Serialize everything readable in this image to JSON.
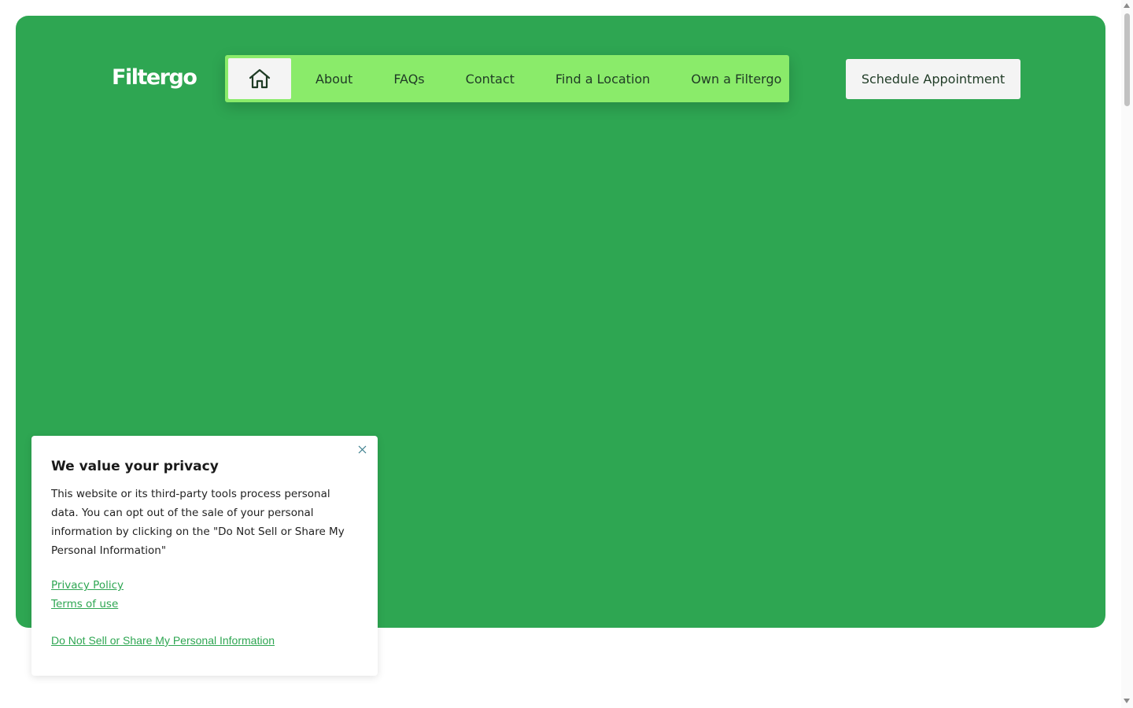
{
  "header": {
    "logo_text": "Filtergo",
    "nav": {
      "home_icon": "home-icon",
      "items": [
        {
          "label": "About"
        },
        {
          "label": "FAQs"
        },
        {
          "label": "Contact"
        },
        {
          "label": "Find a Location"
        },
        {
          "label": "Own a Filtergo"
        }
      ]
    },
    "cta_label": "Schedule Appointment"
  },
  "privacy_banner": {
    "title": "We value your privacy",
    "body": "This website or its third-party tools process personal data. You can opt out of the sale of your personal information by clicking on the \"Do Not Sell or Share My Personal Information\"",
    "links": {
      "privacy_policy": "Privacy Policy",
      "terms_of_use": "Terms of use"
    },
    "opt_out_label": "Do Not Sell or Share My Personal Information",
    "close_icon": "close-icon"
  },
  "colors": {
    "brand_green": "#2ea652",
    "nav_green": "#8aeb6a",
    "button_bg": "#f4f4f4",
    "nav_text": "#1f3b25"
  }
}
